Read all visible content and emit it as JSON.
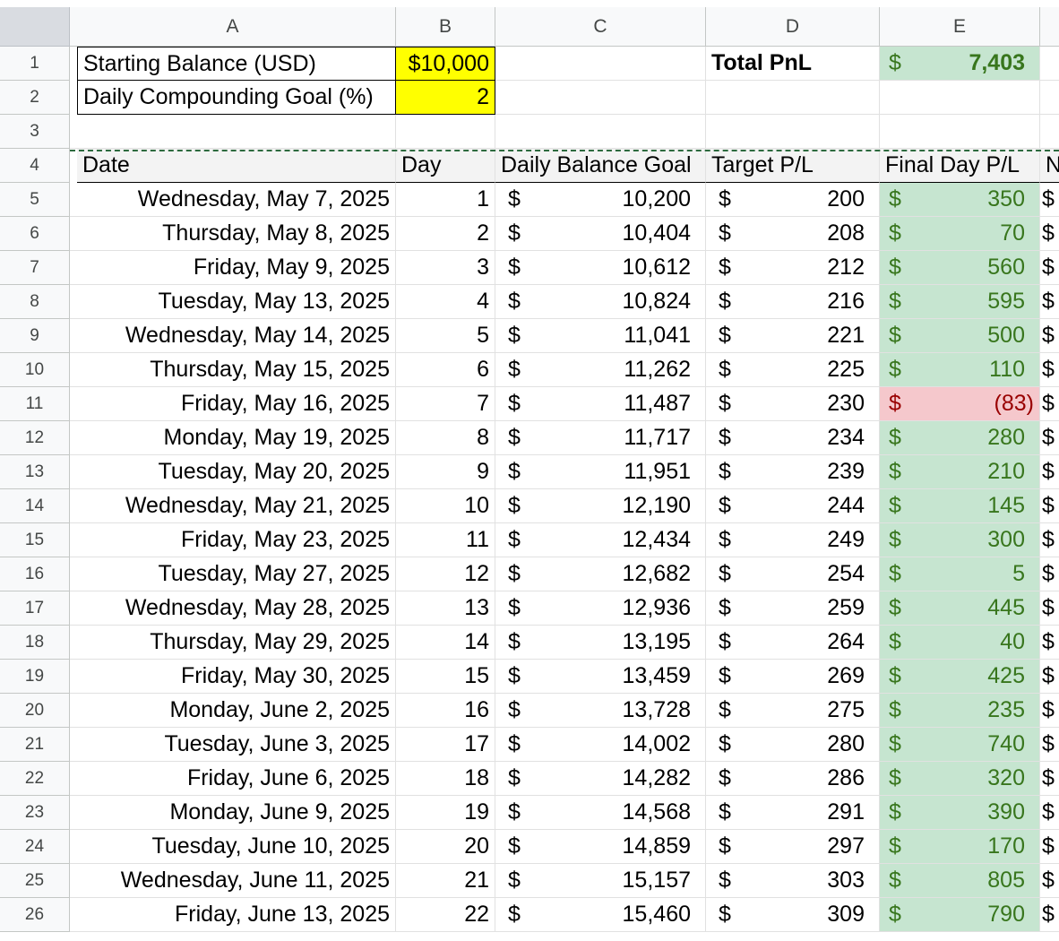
{
  "columns": [
    "A",
    "B",
    "C",
    "D",
    "E",
    ""
  ],
  "summary": {
    "starting_balance_label": "Starting Balance (USD)",
    "starting_balance_value": "$10,000",
    "daily_goal_label": "Daily Compounding Goal (%)",
    "daily_goal_value": "2",
    "total_pnl_label": "Total PnL",
    "total_pnl_currency": "$",
    "total_pnl_value": "7,403"
  },
  "headers": {
    "date": "Date",
    "day": "Day",
    "daily_balance_goal": "Daily Balance Goal",
    "target_pl": "Target P/L",
    "final_day_pl": "Final Day P/L",
    "next_col_partial": "N"
  },
  "currency_symbol": "$",
  "colors": {
    "input_yellow": "#ffff00",
    "profit_green_fill": "#c6e5d0",
    "profit_green_text": "#38761d",
    "loss_red_fill": "#f5c8cc",
    "loss_red_text": "#990000"
  },
  "row_numbers": [
    "1",
    "2",
    "3",
    "4",
    "5",
    "6",
    "7",
    "8",
    "9",
    "10",
    "11",
    "12",
    "13",
    "14",
    "15",
    "16",
    "17",
    "18",
    "19",
    "20",
    "21",
    "22",
    "23",
    "24",
    "25",
    "26"
  ],
  "table": [
    {
      "date": "Wednesday, May 7, 2025",
      "day": "1",
      "goal": "10,200",
      "target": "200",
      "final": "350",
      "loss": false
    },
    {
      "date": "Thursday, May 8, 2025",
      "day": "2",
      "goal": "10,404",
      "target": "208",
      "final": "70",
      "loss": false
    },
    {
      "date": "Friday, May 9, 2025",
      "day": "3",
      "goal": "10,612",
      "target": "212",
      "final": "560",
      "loss": false
    },
    {
      "date": "Tuesday, May 13, 2025",
      "day": "4",
      "goal": "10,824",
      "target": "216",
      "final": "595",
      "loss": false
    },
    {
      "date": "Wednesday, May 14, 2025",
      "day": "5",
      "goal": "11,041",
      "target": "221",
      "final": "500",
      "loss": false
    },
    {
      "date": "Thursday, May 15, 2025",
      "day": "6",
      "goal": "11,262",
      "target": "225",
      "final": "110",
      "loss": false
    },
    {
      "date": "Friday, May 16, 2025",
      "day": "7",
      "goal": "11,487",
      "target": "230",
      "final": "(83)",
      "loss": true
    },
    {
      "date": "Monday, May 19, 2025",
      "day": "8",
      "goal": "11,717",
      "target": "234",
      "final": "280",
      "loss": false
    },
    {
      "date": "Tuesday, May 20, 2025",
      "day": "9",
      "goal": "11,951",
      "target": "239",
      "final": "210",
      "loss": false
    },
    {
      "date": "Wednesday, May 21, 2025",
      "day": "10",
      "goal": "12,190",
      "target": "244",
      "final": "145",
      "loss": false
    },
    {
      "date": "Friday, May 23, 2025",
      "day": "11",
      "goal": "12,434",
      "target": "249",
      "final": "300",
      "loss": false
    },
    {
      "date": "Tuesday, May 27, 2025",
      "day": "12",
      "goal": "12,682",
      "target": "254",
      "final": "5",
      "loss": false
    },
    {
      "date": "Wednesday, May 28, 2025",
      "day": "13",
      "goal": "12,936",
      "target": "259",
      "final": "445",
      "loss": false
    },
    {
      "date": "Thursday, May 29, 2025",
      "day": "14",
      "goal": "13,195",
      "target": "264",
      "final": "40",
      "loss": false
    },
    {
      "date": "Friday, May 30, 2025",
      "day": "15",
      "goal": "13,459",
      "target": "269",
      "final": "425",
      "loss": false
    },
    {
      "date": "Monday, June 2, 2025",
      "day": "16",
      "goal": "13,728",
      "target": "275",
      "final": "235",
      "loss": false
    },
    {
      "date": "Tuesday, June 3, 2025",
      "day": "17",
      "goal": "14,002",
      "target": "280",
      "final": "740",
      "loss": false
    },
    {
      "date": "Friday, June 6, 2025",
      "day": "18",
      "goal": "14,282",
      "target": "286",
      "final": "320",
      "loss": false
    },
    {
      "date": "Monday, June 9, 2025",
      "day": "19",
      "goal": "14,568",
      "target": "291",
      "final": "390",
      "loss": false
    },
    {
      "date": "Tuesday, June 10, 2025",
      "day": "20",
      "goal": "14,859",
      "target": "297",
      "final": "170",
      "loss": false
    },
    {
      "date": "Wednesday, June 11, 2025",
      "day": "21",
      "goal": "15,157",
      "target": "303",
      "final": "805",
      "loss": false
    },
    {
      "date": "Friday, June 13, 2025",
      "day": "22",
      "goal": "15,460",
      "target": "309",
      "final": "790",
      "loss": false
    }
  ]
}
